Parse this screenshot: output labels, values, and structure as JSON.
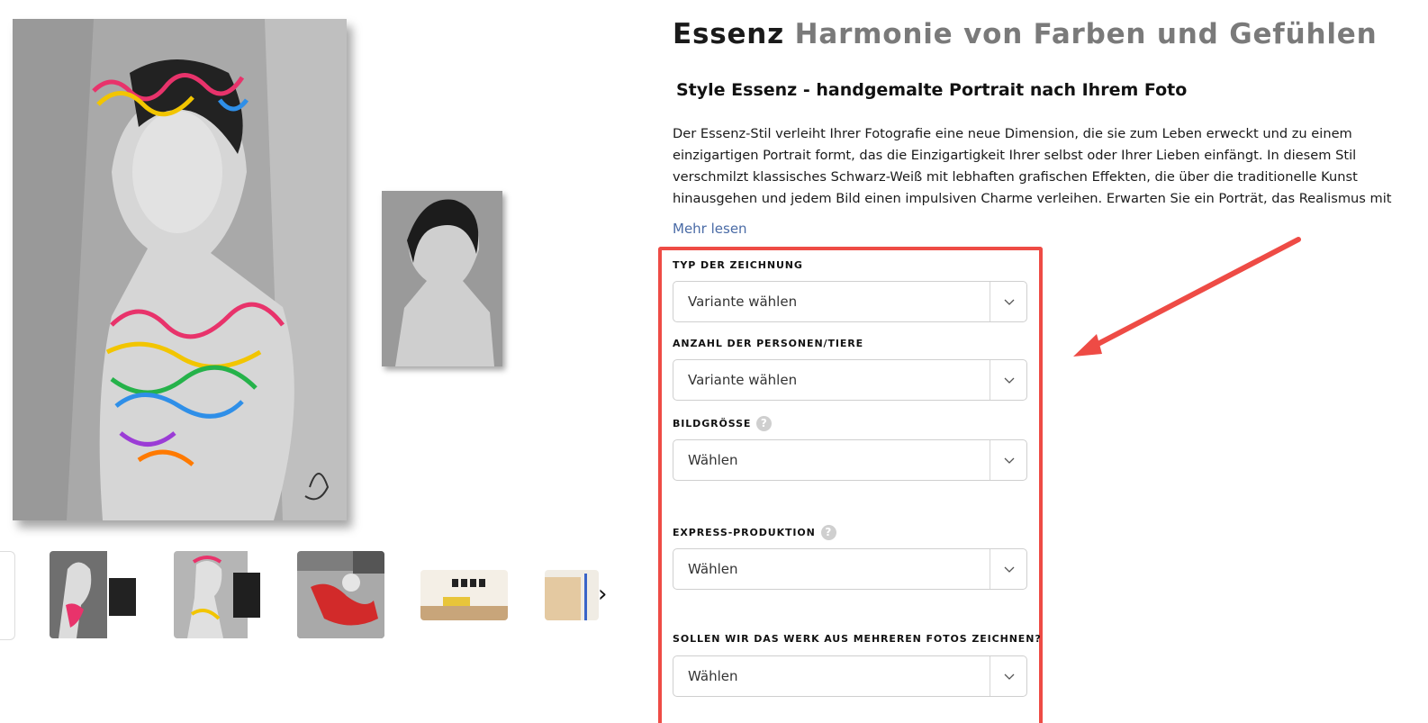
{
  "product": {
    "title_main": "Essenz",
    "title_sub": "Harmonie von Farben und Gefühlen",
    "subtitle": "Style Essenz - handgemalte Portrait nach Ihrem Foto",
    "description": "Der Essenz-Stil verleiht Ihrer Fotografie eine neue Dimension, die sie zum Leben erweckt und zu einem einzigartigen Portrait formt, das die Einzigartigkeit Ihrer selbst oder Ihrer Lieben einfängt. In diesem Stil verschmilzt klassisches Schwarz-Weiß mit lebhaften grafischen Effekten, die über die traditionelle Kunst hinausgehen und jedem Bild einen impulsiven Charme verleihen. Erwarten Sie ein Porträt, das Realismus mit kühner Bildsprache vereint und einen",
    "read_more": "Mehr lesen"
  },
  "options": [
    {
      "label": "TYP DER ZEICHNUNG",
      "value": "Variante wählen",
      "help": false
    },
    {
      "label": "ANZAHL DER PERSONEN/TIERE",
      "value": "Variante wählen",
      "help": false
    },
    {
      "label": "BILDGRÖSSE",
      "value": "Wählen",
      "help": true
    },
    {
      "label": "EXPRESS-PRODUKTION",
      "value": "Wählen",
      "help": true
    },
    {
      "label": "SOLLEN WIR DAS WERK AUS MEHREREN FOTOS ZEICHNEN?",
      "value": "Wählen",
      "help": false
    }
  ],
  "help_glyph": "?",
  "gallery": {
    "next_glyph": "›",
    "thumbnails": [
      "thumb-1",
      "thumb-2",
      "thumb-3",
      "thumb-4",
      "thumb-5",
      "thumb-6"
    ]
  },
  "colors": {
    "highlight_border": "#ee4b45",
    "link": "#4a6ba6",
    "title_gray": "#7a7a7a"
  }
}
